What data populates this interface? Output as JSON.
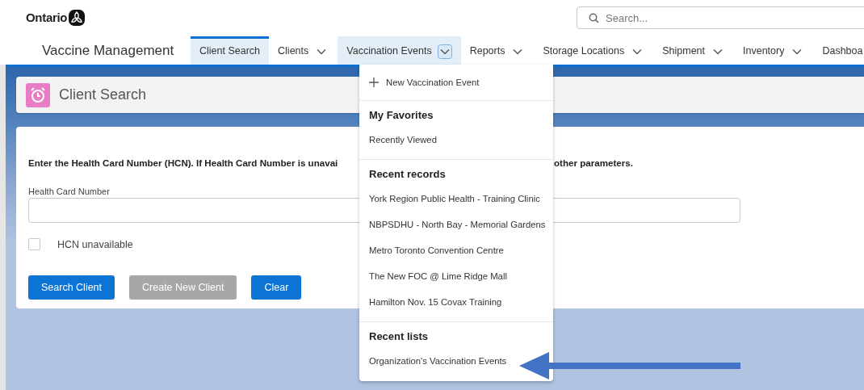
{
  "brand": {
    "name": "Ontario"
  },
  "search": {
    "placeholder": "Search..."
  },
  "app": {
    "title": "Vaccine Management"
  },
  "tabs": [
    {
      "label": "Client Search",
      "selected": true,
      "dropdown": false,
      "open": false
    },
    {
      "label": "Clients",
      "selected": false,
      "dropdown": true,
      "open": false
    },
    {
      "label": "Vaccination Events",
      "selected": false,
      "dropdown": true,
      "open": true
    },
    {
      "label": "Reports",
      "selected": false,
      "dropdown": true,
      "open": false
    },
    {
      "label": "Storage Locations",
      "selected": false,
      "dropdown": true,
      "open": false
    },
    {
      "label": "Shipment",
      "selected": false,
      "dropdown": true,
      "open": false
    },
    {
      "label": "Inventory",
      "selected": false,
      "dropdown": true,
      "open": false
    },
    {
      "label": "Dashboa",
      "selected": false,
      "dropdown": false,
      "open": false
    }
  ],
  "menu": {
    "action": "New Vaccination Event",
    "sections": [
      {
        "heading": "My Favorites",
        "items": [
          "Recently Viewed"
        ]
      },
      {
        "heading": "Recent records",
        "items": [
          "York Region Public Health - Training Clinic",
          "NBPSDHU - North Bay - Memorial Gardens",
          "Metro Toronto Convention Centre",
          "The New FOC @ Lime Ridge Mall",
          "Hamilton Nov. 15 Covax Training"
        ]
      },
      {
        "heading": "Recent lists",
        "items": [
          "Organization's Vaccination Events"
        ]
      }
    ]
  },
  "page": {
    "title": "Client Search"
  },
  "form": {
    "instruction_start": "Enter the Health Card Number (HCN). If Health Card Number is unavai",
    "instruction_end": "other parameters.",
    "hcn_label": "Health Card Number",
    "checkbox": {
      "label": "HCN unavailable",
      "checked": false
    },
    "buttons": [
      {
        "label": "Search Client",
        "disabled": false
      },
      {
        "label": "Create New Client",
        "disabled": true
      },
      {
        "label": "Clear",
        "disabled": false
      }
    ]
  }
}
